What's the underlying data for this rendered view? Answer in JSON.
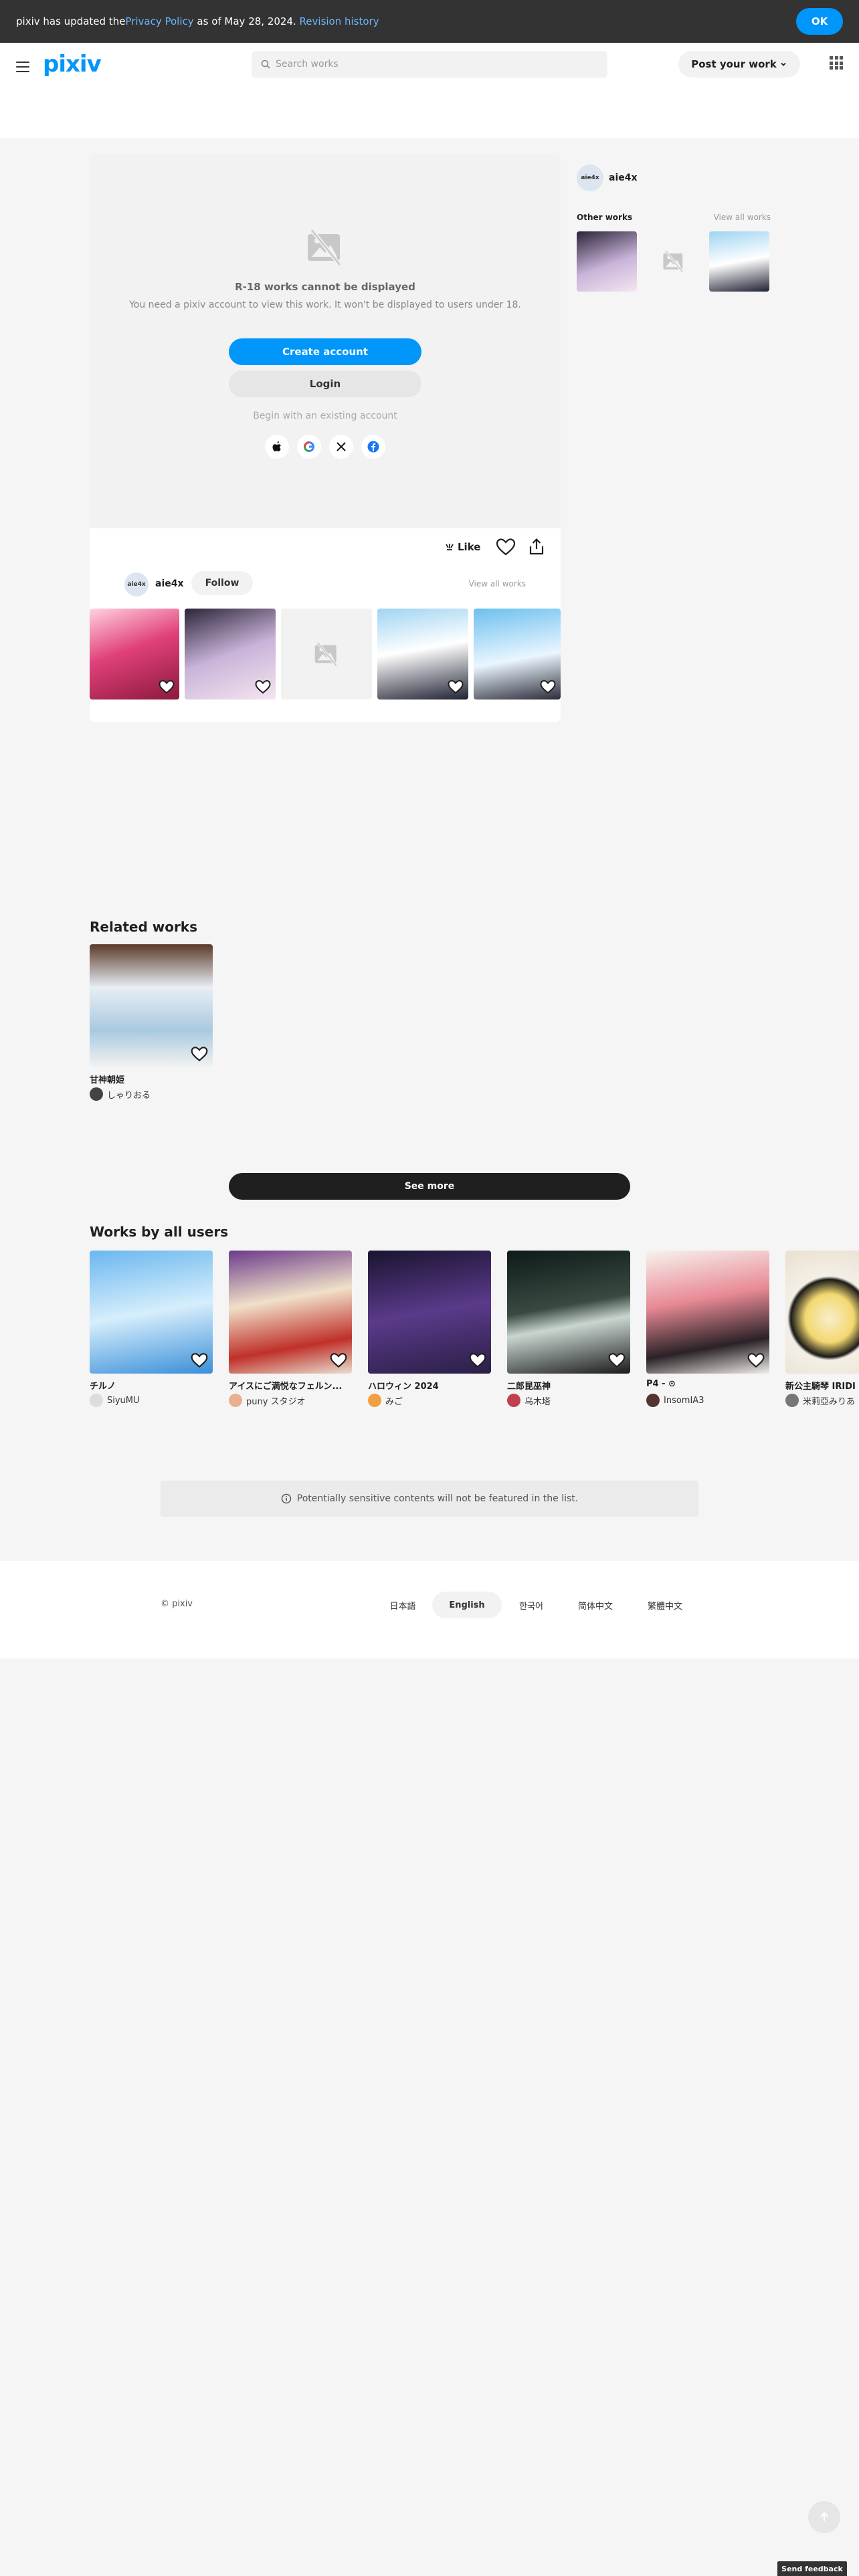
{
  "banner": {
    "text_before": "pixiv has updated the ",
    "policy_link": "Privacy Policy",
    "text_after": " as of May 28, 2024. ",
    "history_link": "Revision history",
    "ok_label": "OK"
  },
  "header": {
    "logo": "pixiv",
    "search_placeholder": "Search works",
    "post_label": "Post your work"
  },
  "gate": {
    "title": "R-18 works cannot be displayed",
    "description": "You need a pixiv account to view this work. It won't be displayed to users under 18.",
    "create_label": "Create account",
    "login_label": "Login",
    "begin_label": "Begin with an existing account",
    "social": [
      "apple-icon",
      "google-icon",
      "x-icon",
      "facebook-icon"
    ]
  },
  "actions": {
    "like_label": "Like"
  },
  "author": {
    "avatar_text": "aie4x",
    "name": "aie4x",
    "follow_label": "Follow",
    "view_all": "View all works"
  },
  "sidebar": {
    "avatar_text": "aie4x",
    "name": "aie4x",
    "other_label": "Other works",
    "view_all": "View all works"
  },
  "related": {
    "title": "Related works",
    "items": [
      {
        "title": "甘神朝姫",
        "user": "しゃりおる"
      }
    ]
  },
  "see_more_label": "See more",
  "all_users": {
    "title": "Works by all users",
    "items": [
      {
        "title": "チルノ",
        "user": "SiyuMU"
      },
      {
        "title": "アイスにご満悦なフェルン...",
        "user": "puny スタジオ"
      },
      {
        "title": "ハロウィン 2024",
        "user": "みご"
      },
      {
        "title": "二郎昆巫神",
        "user": "乌木塔"
      },
      {
        "title": "P4 - ⊙",
        "user": "InsomIA3"
      },
      {
        "title": "新公主騎琴 IRIDI",
        "user": "米莉亞みりあ"
      }
    ]
  },
  "notice": "Potentially sensitive contents will not be featured in the list.",
  "footer": {
    "copyright": "© pixiv",
    "languages": [
      "日本語",
      "English",
      "한국어",
      "简体中文",
      "繁體中文"
    ],
    "active_language": "English"
  },
  "feedback_label": "Send feedback",
  "colors": {
    "accent": "#0096fa",
    "banner_bg": "#333333",
    "page_bg": "#f5f5f5"
  }
}
